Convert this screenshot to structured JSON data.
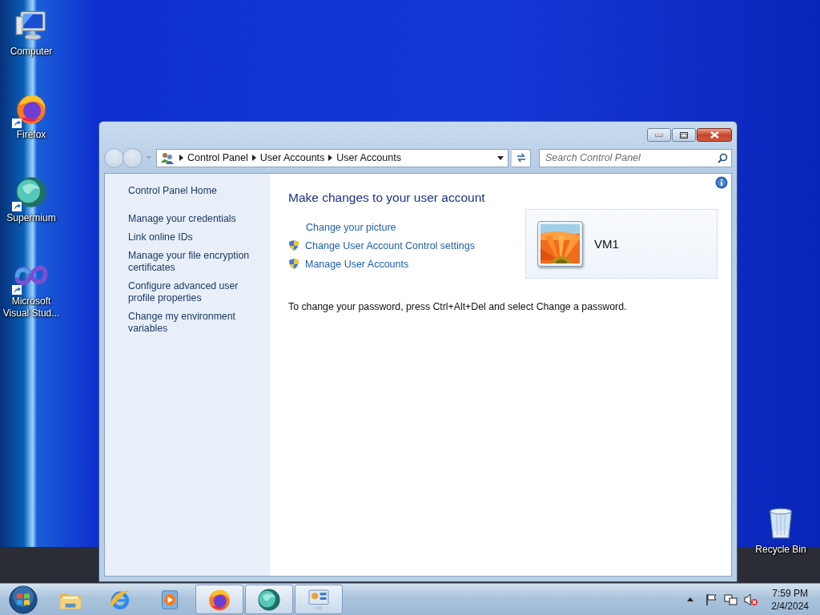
{
  "desktop_icons": [
    {
      "label": "Computer",
      "kind": "computer",
      "shortcut": false
    },
    {
      "label": "Firefox",
      "kind": "firefox",
      "shortcut": true
    },
    {
      "label": "Supermium",
      "kind": "supermium",
      "shortcut": true
    },
    {
      "label": "Microsoft Visual Stud...",
      "kind": "vs",
      "shortcut": true
    }
  ],
  "recycle_bin": {
    "label": "Recycle Bin"
  },
  "window": {
    "nav": {
      "back_disabled": true,
      "forward_disabled": true
    },
    "breadcrumb": [
      "Control Panel",
      "User Accounts",
      "User Accounts"
    ],
    "search": {
      "placeholder": "Search Control Panel"
    },
    "sidebar": {
      "home": "Control Panel Home",
      "tasks": [
        "Manage your credentials",
        "Link online IDs",
        "Manage your file encryption certificates",
        "Configure advanced user profile properties",
        "Change my environment variables"
      ]
    },
    "heading": "Make changes to your user account",
    "links": [
      {
        "label": "Change your picture",
        "kind": "plain"
      },
      {
        "label": "Change User Account Control settings",
        "kind": "shield"
      },
      {
        "label": "Manage User Accounts",
        "kind": "shield"
      }
    ],
    "account": {
      "name": "VM1"
    },
    "note": "To change your password, press Ctrl+Alt+Del and select Change a password."
  },
  "taskbar": {
    "buttons": [
      {
        "kind": "folder",
        "running": false
      },
      {
        "kind": "ie",
        "running": false
      },
      {
        "kind": "media",
        "running": false
      },
      {
        "kind": "firefox",
        "running": true
      },
      {
        "kind": "supermium",
        "running": true
      },
      {
        "kind": "controlpanel",
        "running": true
      }
    ],
    "clock": {
      "time": "7:59 PM",
      "date": "2/4/2024"
    }
  }
}
